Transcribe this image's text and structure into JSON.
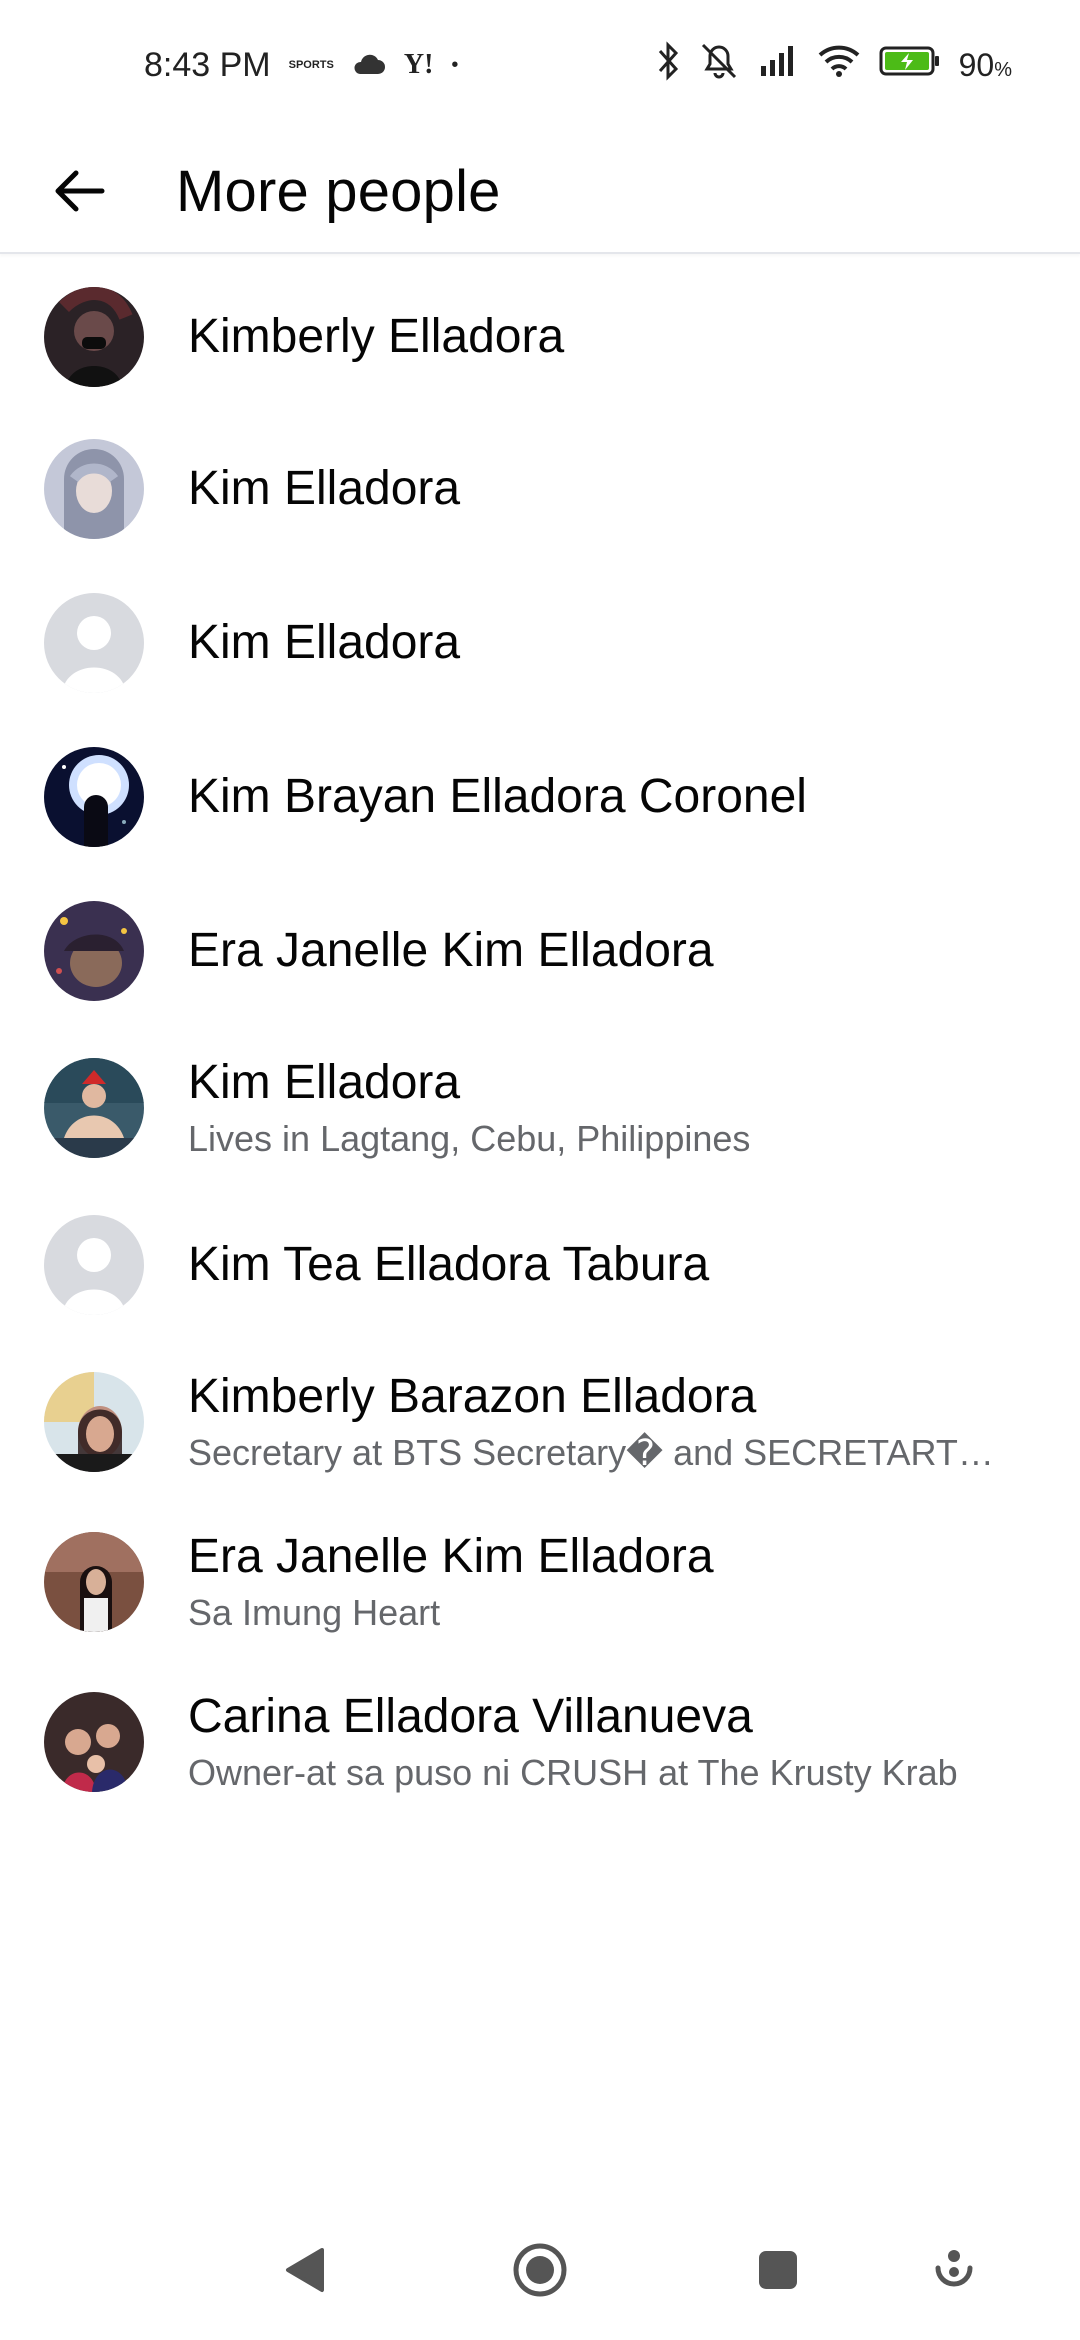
{
  "status_bar": {
    "time": "8:43 PM",
    "notif_app_label": "SPORTS",
    "yahoo_label": "Y!",
    "dot": "•",
    "battery_percent": "90",
    "battery_unit": "%",
    "icons": [
      "cloud-icon",
      "bluetooth-icon",
      "mute-icon",
      "signal-icon",
      "wifi-icon",
      "battery-charging-icon"
    ]
  },
  "header": {
    "title": "More people",
    "back_icon": "arrow-left-icon"
  },
  "people": [
    {
      "name": "Kimberly Elladora",
      "subtitle": "",
      "avatar_color": "#3a2a2e"
    },
    {
      "name": "Kim Elladora",
      "subtitle": "",
      "avatar_color": "#9aa0b8"
    },
    {
      "name": "Kim Elladora",
      "subtitle": "",
      "avatar_color": "#d8dadf"
    },
    {
      "name": "Kim Brayan Elladora Coronel",
      "subtitle": "",
      "avatar_color": "#1b2a5e"
    },
    {
      "name": "Era Janelle Kim Elladora",
      "subtitle": "",
      "avatar_color": "#5a4a6e"
    },
    {
      "name": "Kim Elladora",
      "subtitle": "Lives in Lagtang, Cebu, Philippines",
      "avatar_color": "#4a6a7a"
    },
    {
      "name": "Kim Tea Elladora Tabura",
      "subtitle": "",
      "avatar_color": "#d8dadf"
    },
    {
      "name": "Kimberly Barazon Elladora",
      "subtitle": "Secretary at BTS Secretary� and SECRETART…",
      "avatar_color": "#c8b890"
    },
    {
      "name": "Era Janelle Kim Elladora",
      "subtitle": "Sa Imung Heart",
      "avatar_color": "#6a4a3a"
    },
    {
      "name": "Carina Elladora Villanueva",
      "subtitle": "Owner-at sa puso ni CRUSH at The Krusty Krab",
      "avatar_color": "#4a3a3a"
    }
  ],
  "nav": {
    "icons": [
      "back-triangle-icon",
      "home-circle-icon",
      "recents-square-icon",
      "assistant-icon"
    ]
  }
}
